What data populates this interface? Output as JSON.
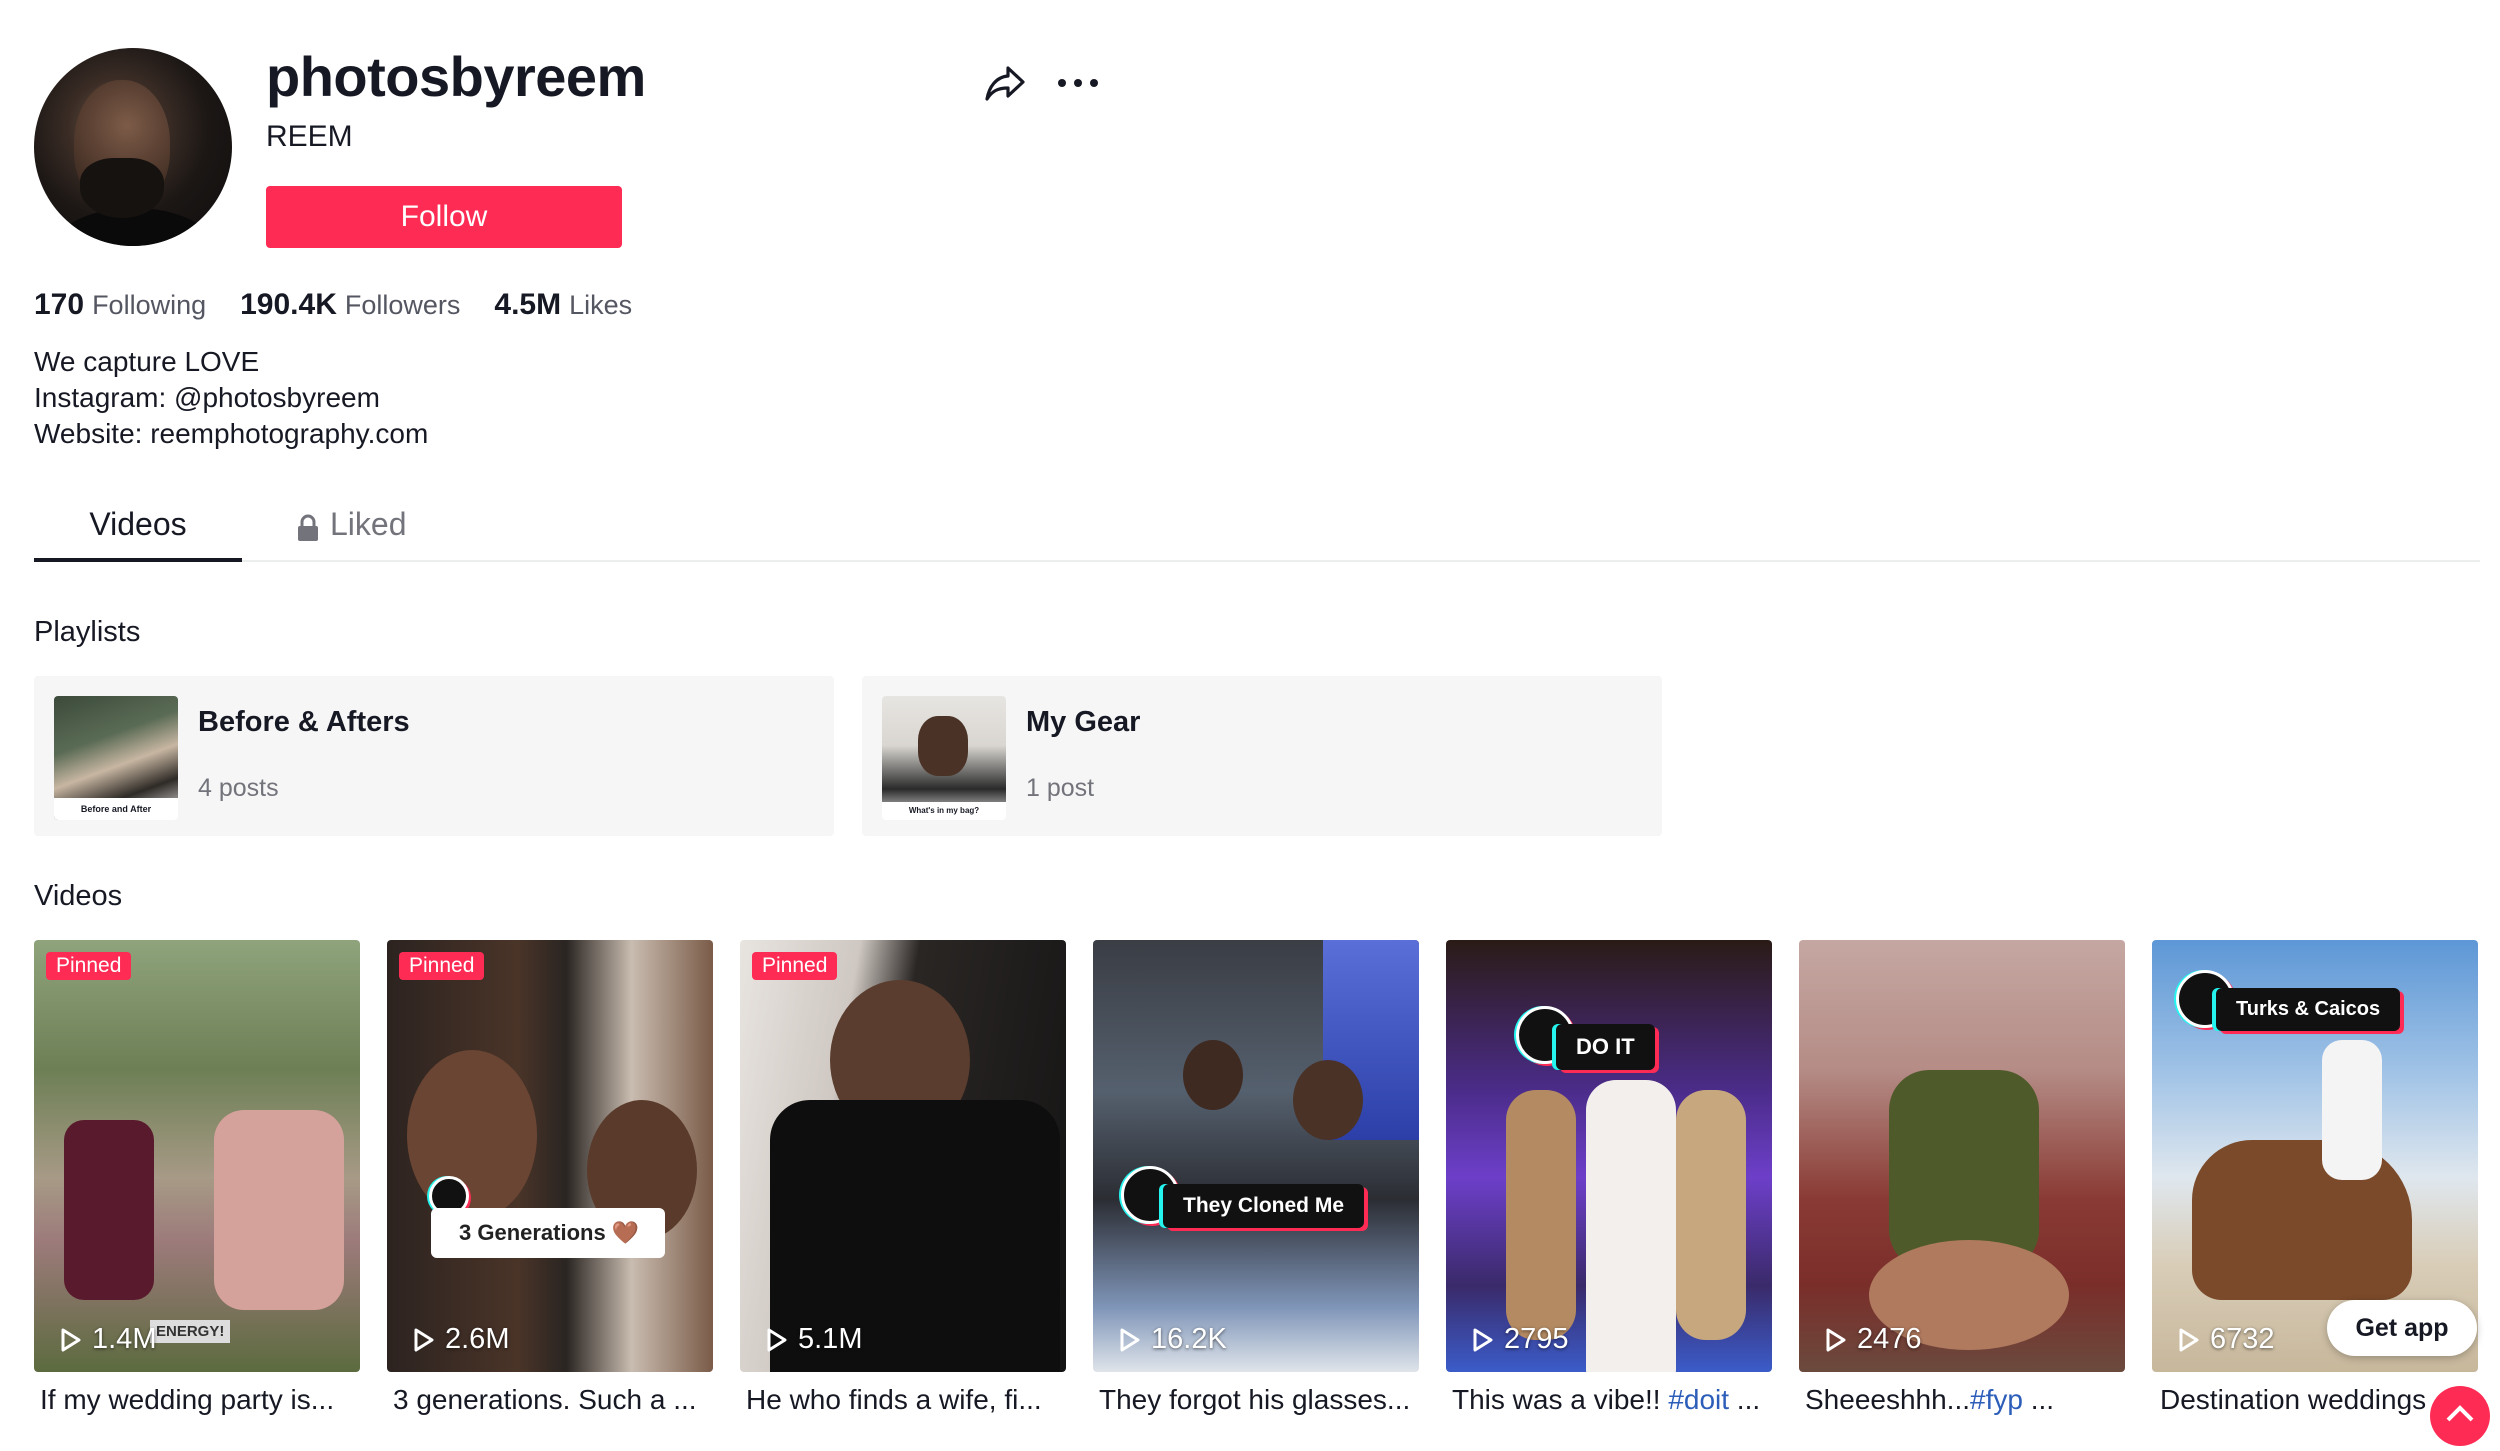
{
  "profile": {
    "username": "photosbyreem",
    "nickname": "REEM",
    "follow_label": "Follow",
    "share_icon": "share-icon",
    "more_icon": "more-icon"
  },
  "stats": [
    {
      "value": "170",
      "label": "Following"
    },
    {
      "value": "190.4K",
      "label": "Followers"
    },
    {
      "value": "4.5M",
      "label": "Likes"
    }
  ],
  "bio": {
    "line1": "We capture LOVE",
    "line2": "Instagram: @photosbyreem",
    "line3": "Website: reemphotography.com"
  },
  "tabs": {
    "videos": "Videos",
    "liked": "Liked"
  },
  "playlists_title": "Playlists",
  "playlists": [
    {
      "name": "Before & Afters",
      "count": "4 posts",
      "thumb_text": "Before and After"
    },
    {
      "name": "My Gear",
      "count": "1 post",
      "thumb_text": "What's in my bag?"
    }
  ],
  "videos_title": "Videos",
  "videos": [
    {
      "pinned": "Pinned",
      "views": "1.4M",
      "caption": "If my wedding party is...",
      "overlay": "ENERGY!"
    },
    {
      "pinned": "Pinned",
      "views": "2.6M",
      "caption": "3 generations. Such a ...",
      "overlay": "3 Generations 🤎"
    },
    {
      "pinned": "Pinned",
      "views": "5.1M",
      "caption": "He who finds a wife, fi..."
    },
    {
      "views": "16.2K",
      "caption": "They forgot his glasses...",
      "overlay": "They Cloned Me"
    },
    {
      "views": "2795",
      "caption_text": "This was a vibe!! ",
      "caption_tag": "#doit",
      "caption_end": " ...",
      "overlay": "DO IT"
    },
    {
      "views": "2476",
      "caption_text": "Sheeeshhh...",
      "caption_tag": "#fyp",
      "caption_end": " ..."
    },
    {
      "views": "6732",
      "caption": "Destination weddings",
      "overlay": "Turks & Caicos"
    }
  ],
  "get_app_label": "Get app",
  "colors": {
    "accent": "#fe2c55",
    "link": "#2b5db9"
  }
}
